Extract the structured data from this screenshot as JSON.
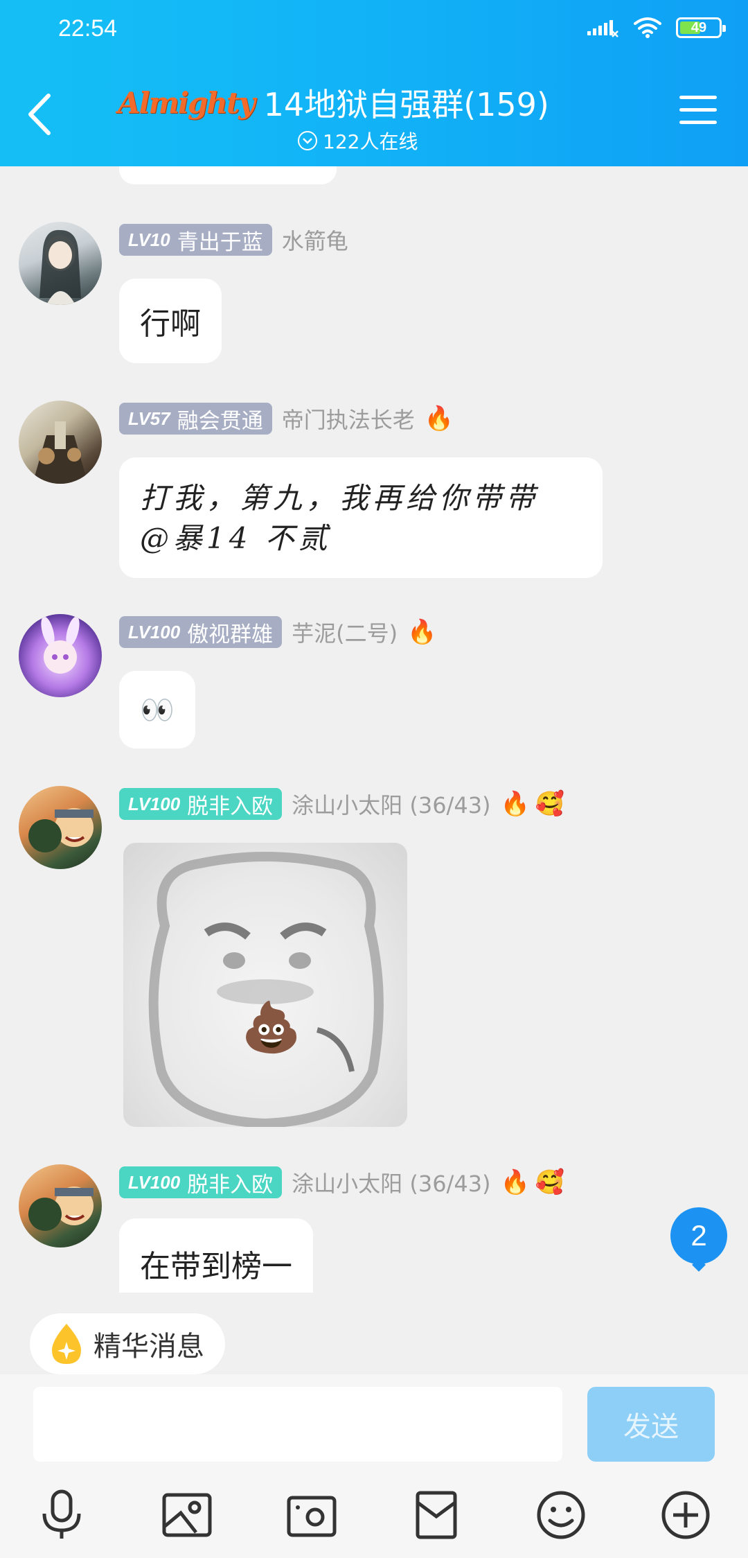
{
  "status_bar": {
    "time": "22:54",
    "battery": "49"
  },
  "header": {
    "logo": "Almighty",
    "title": "14地狱自强群(159)",
    "online": "122人在线"
  },
  "messages": [
    {
      "level": "LV10",
      "rank": "青出于蓝",
      "nickname": "水箭龟",
      "text": "行啊"
    },
    {
      "level": "LV57",
      "rank": "融会贯通",
      "nickname": "帝门执法长老",
      "badge": "🔥",
      "text_line1": "打我，第九，我再给你带带",
      "text_line2": "@暴14  不贰"
    },
    {
      "level": "LV100",
      "rank": "傲视群雄",
      "nickname": "芋泥(二号)",
      "badge": "🔥",
      "text": "👀"
    },
    {
      "level": "LV100",
      "rank": "脱非入欧",
      "nickname": "涂山小太阳 (36/43)",
      "badge": "🔥",
      "badge2": "🥰",
      "sticker": "💩"
    },
    {
      "level": "LV100",
      "rank": "脱非入欧",
      "nickname": "涂山小太阳 (36/43)",
      "badge": "🔥",
      "badge2": "🥰",
      "text": "在带到榜一"
    }
  ],
  "unread_count": "2",
  "essence": {
    "label": "精华消息"
  },
  "input": {
    "placeholder": "",
    "send_label": "发送"
  },
  "toolbar": [
    "microphone-icon",
    "image-icon",
    "camera-icon",
    "red-packet-icon",
    "emoji-icon",
    "plus-icon"
  ]
}
